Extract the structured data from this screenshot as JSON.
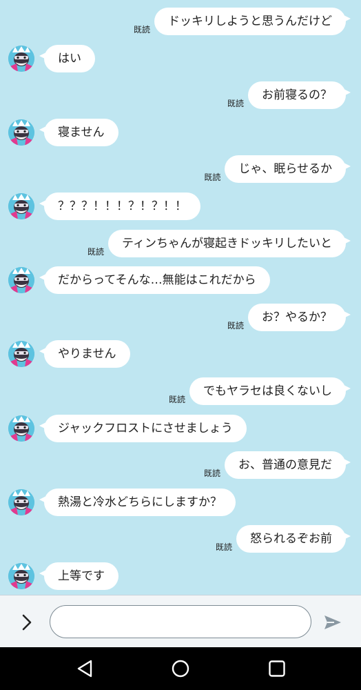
{
  "chat": {
    "messages": [
      {
        "from": "me",
        "text": "ドッキリしようと思うんだけど",
        "read": "既読"
      },
      {
        "from": "them",
        "text": "はい"
      },
      {
        "from": "me",
        "text": "お前寝るの？",
        "read": "既読"
      },
      {
        "from": "them",
        "text": "寝ません"
      },
      {
        "from": "me",
        "text": "じゃ、眠らせるか",
        "read": "既読"
      },
      {
        "from": "them",
        "text": "？？？！！！？！？！！"
      },
      {
        "from": "me",
        "text": "ティンちゃんが寝起きドッキリしたいと",
        "read": "既読"
      },
      {
        "from": "them",
        "text": "だからってそんな…無能はこれだから"
      },
      {
        "from": "me",
        "text": "お？やるか？",
        "read": "既読"
      },
      {
        "from": "them",
        "text": "やりません"
      },
      {
        "from": "me",
        "text": "でもヤラセは良くないし",
        "read": "既読"
      },
      {
        "from": "them",
        "text": "ジャックフロストにさせましょう"
      },
      {
        "from": "me",
        "text": "お、普通の意見だ",
        "read": "既読"
      },
      {
        "from": "them",
        "text": "熱湯と冷水どちらにしますか？"
      },
      {
        "from": "me",
        "text": "怒られるぞお前",
        "read": "既読"
      },
      {
        "from": "them",
        "text": "上等です"
      }
    ]
  },
  "input_bar": {
    "expand_icon": "chevron-right-icon",
    "input_value": "",
    "input_placeholder": "",
    "send_icon": "send-icon"
  },
  "nav_bar": {
    "back_icon": "back-triangle-icon",
    "home_icon": "home-circle-icon",
    "recents_icon": "recents-square-icon"
  },
  "colors": {
    "chat_background": "#bfe6f1",
    "bubble": "#ffffff",
    "input_bar": "#f2f5f7",
    "nav_bar": "#000000"
  }
}
